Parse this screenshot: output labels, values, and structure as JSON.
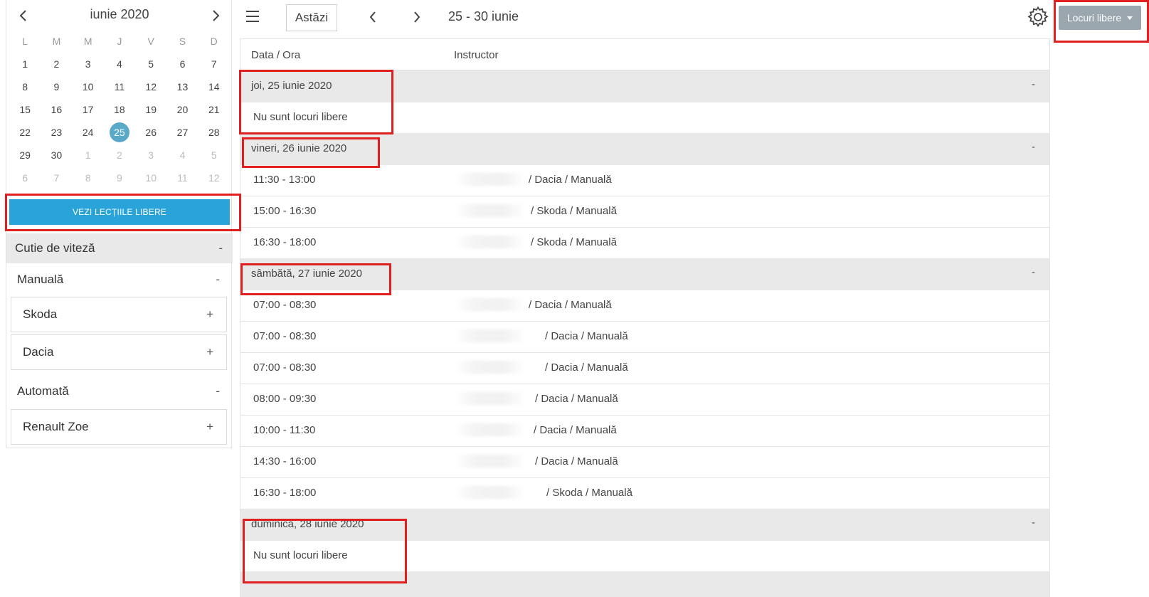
{
  "calendar": {
    "month_title": "iunie 2020",
    "weekdays": [
      "L",
      "M",
      "M",
      "J",
      "V",
      "S",
      "D"
    ],
    "weeks": [
      [
        {
          "d": "1"
        },
        {
          "d": "2"
        },
        {
          "d": "3"
        },
        {
          "d": "4"
        },
        {
          "d": "5"
        },
        {
          "d": "6"
        },
        {
          "d": "7"
        }
      ],
      [
        {
          "d": "8"
        },
        {
          "d": "9"
        },
        {
          "d": "10"
        },
        {
          "d": "11"
        },
        {
          "d": "12"
        },
        {
          "d": "13"
        },
        {
          "d": "14"
        }
      ],
      [
        {
          "d": "15"
        },
        {
          "d": "16"
        },
        {
          "d": "17"
        },
        {
          "d": "18"
        },
        {
          "d": "19"
        },
        {
          "d": "20"
        },
        {
          "d": "21"
        }
      ],
      [
        {
          "d": "22"
        },
        {
          "d": "23"
        },
        {
          "d": "24"
        },
        {
          "d": "25",
          "selected": true
        },
        {
          "d": "26"
        },
        {
          "d": "27"
        },
        {
          "d": "28"
        }
      ],
      [
        {
          "d": "29"
        },
        {
          "d": "30"
        },
        {
          "d": "1",
          "muted": true
        },
        {
          "d": "2",
          "muted": true
        },
        {
          "d": "3",
          "muted": true
        },
        {
          "d": "4",
          "muted": true
        },
        {
          "d": "5",
          "muted": true
        }
      ],
      [
        {
          "d": "6",
          "muted": true
        },
        {
          "d": "7",
          "muted": true
        },
        {
          "d": "8",
          "muted": true
        },
        {
          "d": "9",
          "muted": true
        },
        {
          "d": "10",
          "muted": true
        },
        {
          "d": "11",
          "muted": true
        },
        {
          "d": "12",
          "muted": true
        }
      ]
    ],
    "selected_color": "#5aa9c8"
  },
  "sidebar": {
    "free_lessons_button": "VEZI LECȚIILE LIBERE",
    "gearbox_label": "Cutie de viteză",
    "gearbox_toggle": "-",
    "manual_label": "Manuală",
    "manual_toggle": "-",
    "manual_cars": [
      {
        "name": "Skoda",
        "toggle": "+"
      },
      {
        "name": "Dacia",
        "toggle": "+"
      }
    ],
    "auto_label": "Automată",
    "auto_toggle": "-",
    "auto_cars": [
      {
        "name": "Renault Zoe",
        "toggle": "+"
      }
    ],
    "accent_color": "#2aa3d9"
  },
  "toolbar": {
    "today_label": "Astăzi",
    "range_title": "25 - 30 iunie",
    "filter_label": "Locuri libere",
    "filter_color": "#9aa7af"
  },
  "list": {
    "col_date": "Data / Ora",
    "col_instructor": "Instructor",
    "days": [
      {
        "title": "joi, 25 iunie 2020",
        "collapse": "-",
        "empty_text": "Nu sunt locuri libere",
        "slots": []
      },
      {
        "title": "vineri, 26 iunie 2020",
        "collapse": "-",
        "empty_text": "",
        "slots": [
          {
            "time": "11:30 - 13:00",
            "car": "/ Dacia / Manuală"
          },
          {
            "time": "15:00 - 16:30",
            "car": "/ Skoda / Manuală"
          },
          {
            "time": "16:30 - 18:00",
            "car": "/ Skoda / Manuală"
          }
        ]
      },
      {
        "title": "sâmbătă, 27 iunie 2020",
        "collapse": "-",
        "empty_text": "",
        "slots": [
          {
            "time": "07:00 - 08:30",
            "car": "/ Dacia / Manuală"
          },
          {
            "time": "07:00 - 08:30",
            "car": "/ Dacia / Manuală"
          },
          {
            "time": "07:00 - 08:30",
            "car": "/ Dacia / Manuală"
          },
          {
            "time": "08:00 - 09:30",
            "car": "/ Dacia / Manuală"
          },
          {
            "time": "10:00 - 11:30",
            "car": "/ Dacia / Manuală"
          },
          {
            "time": "14:30 - 16:00",
            "car": "/ Dacia / Manuală"
          },
          {
            "time": "16:30 - 18:00",
            "car": "/ Skoda / Manuală"
          }
        ]
      },
      {
        "title": "duminică, 28 iunie 2020",
        "collapse": "-",
        "empty_text": "Nu sunt locuri libere",
        "slots": []
      }
    ]
  },
  "icons": {
    "prev_month": "chevron-left-icon",
    "next_month": "chevron-right-icon",
    "menu": "hamburger-menu-icon",
    "prev_week": "chevron-left-icon",
    "next_week": "chevron-right-icon",
    "settings": "gear-icon",
    "filter_caret": "caret-down-icon"
  },
  "annotation_color": "#e02020"
}
